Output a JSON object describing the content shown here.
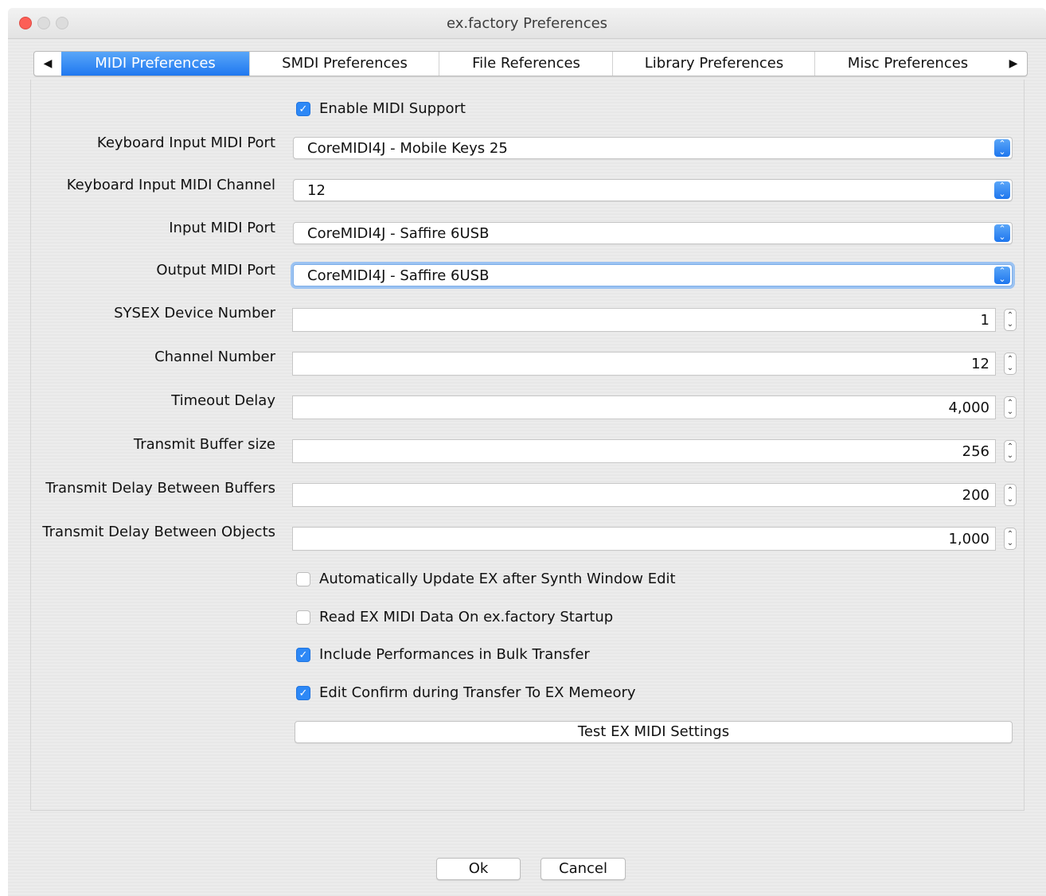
{
  "window": {
    "title": "ex.factory Preferences"
  },
  "tabs": [
    {
      "label": "MIDI Preferences",
      "active": true
    },
    {
      "label": "SMDI Preferences",
      "active": false
    },
    {
      "label": "File References",
      "active": false
    },
    {
      "label": "Library Preferences",
      "active": false
    },
    {
      "label": "Misc Preferences",
      "active": false
    }
  ],
  "tab_arrows": {
    "left": "◀",
    "right": "▶"
  },
  "midi": {
    "enable_midi": {
      "label": "Enable MIDI Support",
      "checked": true
    },
    "keyboard_port": {
      "label": "Keyboard Input MIDI Port",
      "value": "CoreMIDI4J - Mobile Keys 25"
    },
    "keyboard_channel": {
      "label": "Keyboard Input MIDI Channel",
      "value": "12"
    },
    "input_port": {
      "label": "Input MIDI Port",
      "value": "CoreMIDI4J - Saffire 6USB"
    },
    "output_port": {
      "label": "Output MIDI Port",
      "value": "CoreMIDI4J - Saffire 6USB"
    },
    "sysex_device": {
      "label": "SYSEX Device Number",
      "value": "1"
    },
    "channel_number": {
      "label": "Channel Number",
      "value": "12"
    },
    "timeout_delay": {
      "label": "Timeout Delay",
      "value": "4,000"
    },
    "transmit_buffer": {
      "label": "Transmit Buffer size",
      "value": "256"
    },
    "delay_buffers": {
      "label": "Transmit Delay Between Buffers",
      "value": "200"
    },
    "delay_objects": {
      "label": "Transmit Delay Between Objects",
      "value": "1,000"
    },
    "auto_update": {
      "label": "Automatically Update EX after Synth Window Edit",
      "checked": false
    },
    "read_on_startup": {
      "label": "Read EX MIDI Data On ex.factory Startup",
      "checked": false
    },
    "include_performances": {
      "label": "Include Performances in Bulk Transfer",
      "checked": true
    },
    "edit_confirm": {
      "label": "Edit Confirm during Transfer To EX Memeory",
      "checked": true
    },
    "test_button": "Test EX MIDI Settings"
  },
  "footer": {
    "ok": "Ok",
    "cancel": "Cancel"
  },
  "colors": {
    "accent": "#2d88f6",
    "close_button": "#fc5f57"
  },
  "icons": {
    "checkmark": "✓",
    "stepper_up": "⌃",
    "stepper_down": "⌄"
  }
}
